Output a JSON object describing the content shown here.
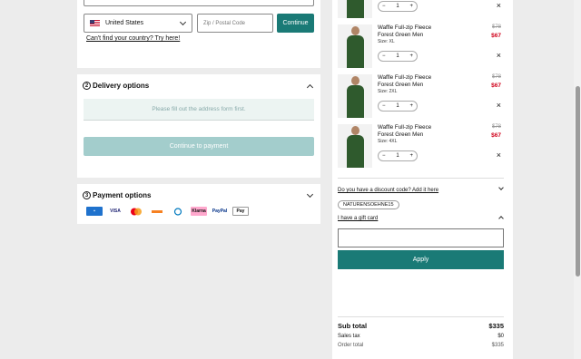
{
  "address": {
    "country": "United States",
    "zip_placeholder": "Zip / Postal Code",
    "continue_label": "Continue",
    "cant_find": "Can't find your country? Try here!"
  },
  "delivery": {
    "number": "2",
    "title": "Delivery options",
    "notice": "Please fill out the address form first.",
    "button": "Continue to payment"
  },
  "payment": {
    "number": "3",
    "title": "Payment options",
    "methods": [
      "amex-icon",
      "visa-icon",
      "mastercard-icon",
      "discover-icon",
      "diners-icon",
      "klarna-icon",
      "paypal-icon",
      "applepay-icon"
    ],
    "labels": {
      "visa": "VISA",
      "klarna": "Klarna",
      "paypal": "PayPal",
      "applepay": "Pay"
    }
  },
  "cart": {
    "first_qty": "1",
    "items": [
      {
        "name": "Waffle Full-zip Fleece",
        "color": "Forest Green Men",
        "size": "Size: XL",
        "old_price": "$78",
        "price": "$67",
        "qty": "1"
      },
      {
        "name": "Waffle Full-zip Fleece",
        "color": "Forest Green Men",
        "size": "Size: 2XL",
        "old_price": "$78",
        "price": "$67",
        "qty": "1"
      },
      {
        "name": "Waffle Full-zip Fleece",
        "color": "Forest Green Men",
        "size": "Size: 4XL",
        "old_price": "$78",
        "price": "$67",
        "qty": "1"
      }
    ],
    "discount_link": "Do you have a discount code? Add it here",
    "discount_code": "NATURENSOEHNE15",
    "gift_link": "I have a gift card",
    "apply_label": "Apply"
  },
  "summary": {
    "subtotal_label": "Sub total",
    "subtotal": "$335",
    "tax_label": "Sales tax",
    "tax": "$0",
    "order_label": "Order total",
    "order": "$335"
  },
  "colors": {
    "accent": "#1a7a76",
    "accent_disabled": "#a3cdcc",
    "sale": "#d0021b"
  }
}
